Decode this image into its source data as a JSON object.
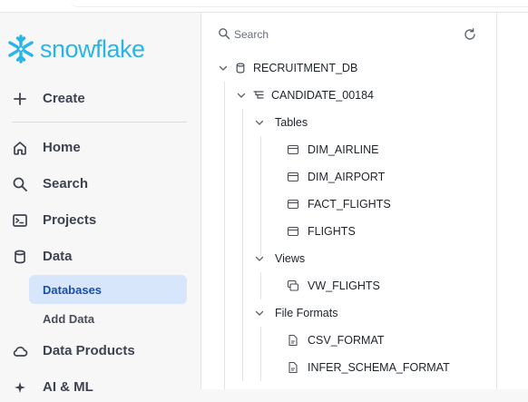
{
  "brand": {
    "name": "snowflake",
    "color": "#29b5e8"
  },
  "sidebar": {
    "create": {
      "label": "Create",
      "icon": "plus-icon"
    },
    "items": [
      {
        "label": "Home",
        "icon": "home-icon"
      },
      {
        "label": "Search",
        "icon": "search-icon"
      },
      {
        "label": "Projects",
        "icon": "terminal-icon"
      },
      {
        "label": "Data",
        "icon": "database-icon"
      }
    ],
    "data_subitems": [
      {
        "label": "Databases",
        "active": true
      },
      {
        "label": "Add Data",
        "active": false
      }
    ],
    "more_items": [
      {
        "label": "Data Products",
        "icon": "cloud-icon"
      },
      {
        "label": "AI & ML",
        "icon": "sparkle-icon"
      }
    ]
  },
  "object_explorer": {
    "search_placeholder": "Search",
    "tree": {
      "database": "RECRUITMENT_DB",
      "schema": "CANDIDATE_00184",
      "groups": {
        "tables": {
          "label": "Tables",
          "items": [
            "DIM_AIRLINE",
            "DIM_AIRPORT",
            "FACT_FLIGHTS",
            "FLIGHTS"
          ]
        },
        "views": {
          "label": "Views",
          "items": [
            "VW_FLIGHTS"
          ]
        },
        "file_formats": {
          "label": "File Formats",
          "items": [
            "CSV_FORMAT",
            "INFER_SCHEMA_FORMAT"
          ]
        }
      }
    }
  }
}
